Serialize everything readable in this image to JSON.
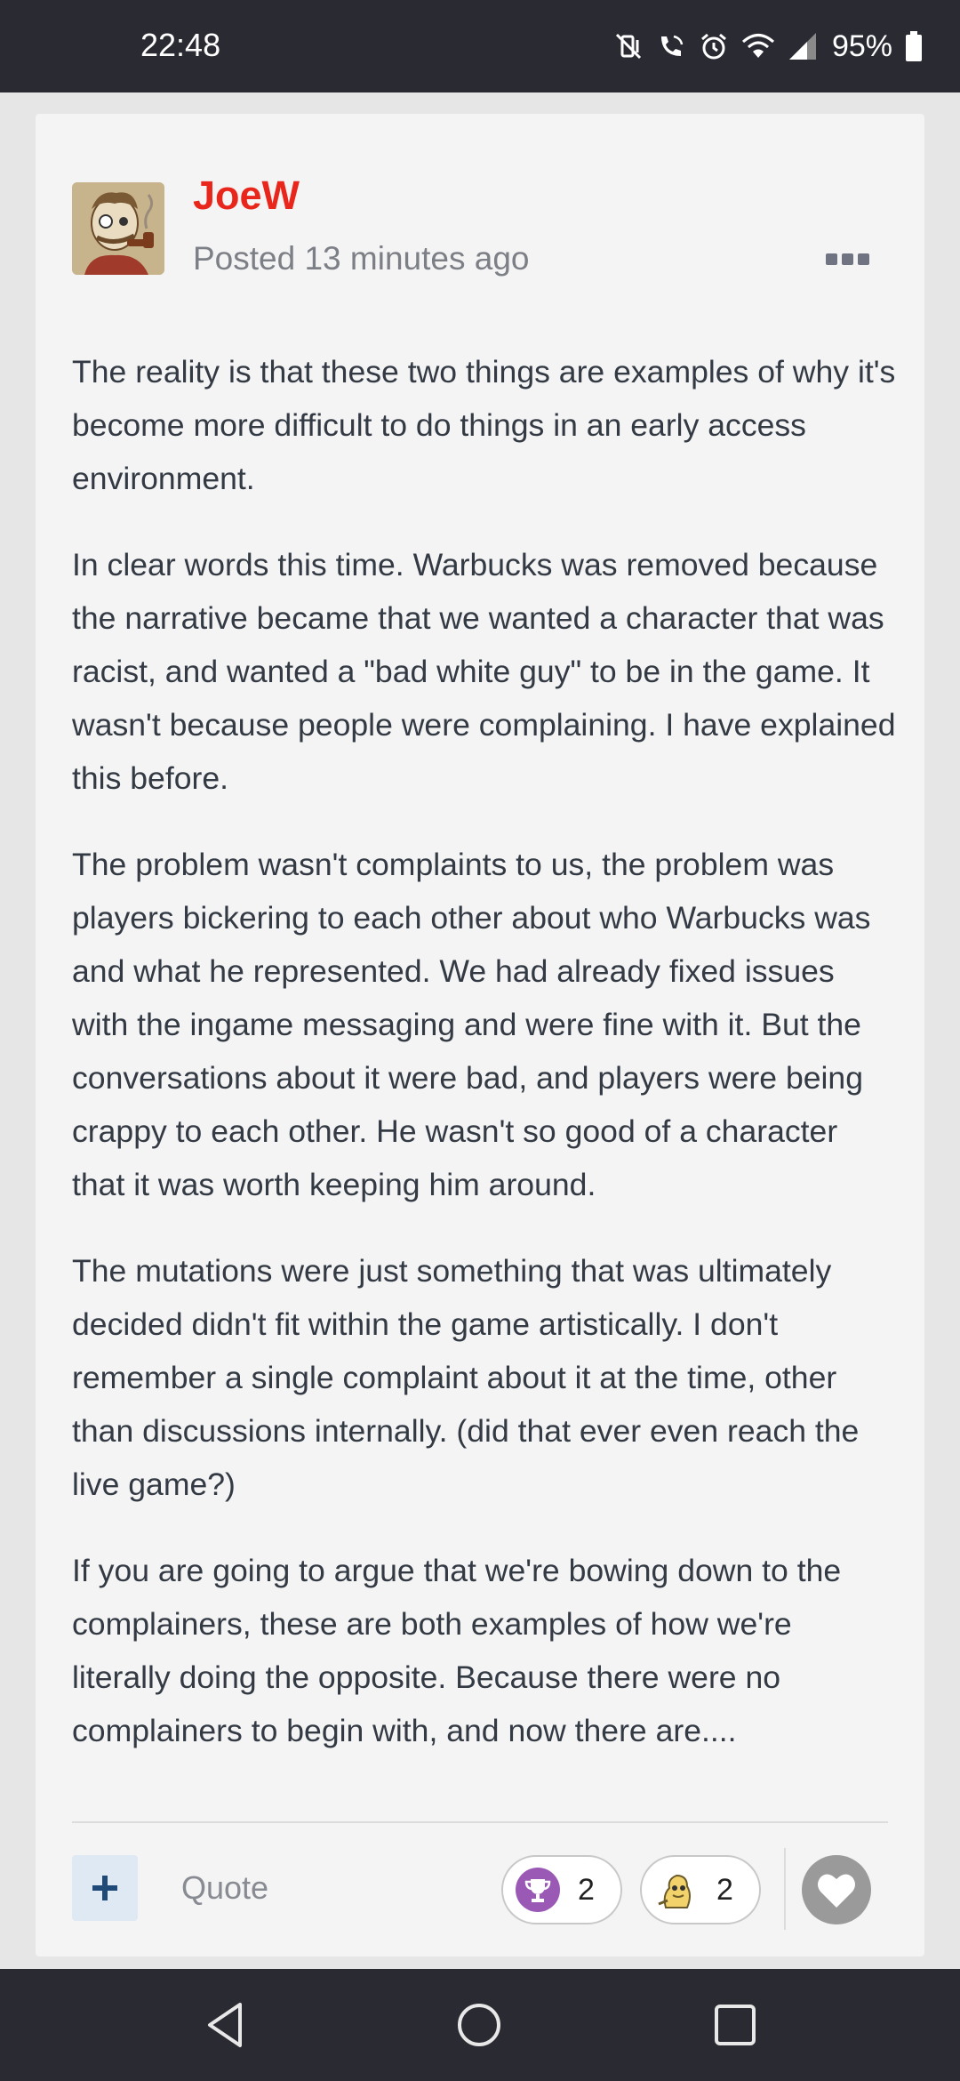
{
  "status_bar": {
    "time": "22:48",
    "battery_percent": "95%",
    "icons": [
      "mute-vibrate-icon",
      "wifi-calling-icon",
      "alarm-icon",
      "wifi-icon",
      "cell-signal-icon",
      "battery-icon"
    ]
  },
  "post": {
    "author": "JoeW",
    "posted": "Posted 13 minutes ago",
    "author_color": "#e8261c",
    "paragraphs": [
      "The reality is that these two things are examples of why it's become more difficult to do things in an early access environment.",
      "In clear words this time. Warbucks was removed because the narrative became that we wanted a character that was racist, and wanted a \"bad white guy\" to be in the game. It wasn't because people were complaining. I have explained this before.",
      "The problem wasn't complaints to us, the problem was players bickering to each other about who Warbucks was and what he represented. We had already fixed issues with the ingame messaging and were fine with it. But the conversations about it were bad, and players were being crappy to each other. He wasn't so good of a character that it was worth keeping him around.",
      "The mutations were just something that was ultimately decided didn't fit within the game artistically. I don't remember a single complaint about it at the time, other than discussions internally. (did that ever even reach the live game?)",
      "If you are going to argue that we're bowing down to the complainers, these are both examples of how we're literally doing the opposite. Because there were no complainers to begin with, and now there are...."
    ]
  },
  "actions": {
    "plus_label": "+",
    "quote_label": "Quote",
    "reactions": [
      {
        "icon": "trophy-icon",
        "count": "2",
        "color": "#9b59b6"
      },
      {
        "icon": "character-reaction-icon",
        "count": "2",
        "color": "#f2d36b"
      }
    ]
  },
  "nav": {
    "icons": [
      "back-icon",
      "home-icon",
      "recents-icon"
    ]
  }
}
